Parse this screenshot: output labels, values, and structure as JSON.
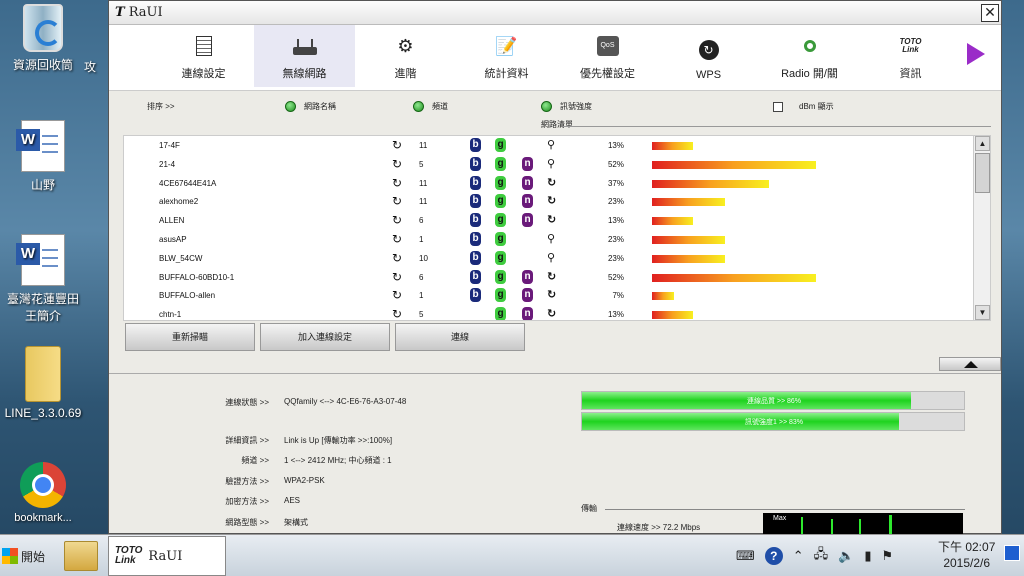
{
  "desktop": {
    "icons": [
      {
        "label": "資源回收筒"
      },
      {
        "label": "攻"
      },
      {
        "label": "山野"
      },
      {
        "label": "臺灣花蓮豐田\n王簡介"
      },
      {
        "label": "LINE_3.3.0.69"
      },
      {
        "label": "bookmark..."
      }
    ]
  },
  "window": {
    "logo": "T",
    "title": "RaUI",
    "close": "✕"
  },
  "toolbar": {
    "tabs": [
      {
        "label": "連線設定",
        "icon": "document-icon"
      },
      {
        "label": "無線網路",
        "icon": "router-icon"
      },
      {
        "label": "進階",
        "icon": "gear-icon"
      },
      {
        "label": "統計資料",
        "icon": "notepad-icon"
      },
      {
        "label": "優先權設定",
        "icon": "qos-icon"
      },
      {
        "label": "WPS",
        "icon": "wps-icon"
      },
      {
        "label": "Radio 開/關",
        "icon": "antenna-icon"
      },
      {
        "label": "資訊",
        "icon": "totolink-icon"
      }
    ],
    "qos_text": "QoS",
    "toto_text": "TOTO\nLink"
  },
  "list_header": {
    "sort": "排序 >>",
    "ssid": "網路名稱",
    "channel": "頻道",
    "signal": "訊號強度",
    "dbm": "dBm 顯示",
    "list_title": "網路清單"
  },
  "networks": [
    {
      "ssid": "17-4F",
      "channel": "11",
      "b": true,
      "g": true,
      "n": false,
      "sec": "key",
      "pct": "13%",
      "value": 13
    },
    {
      "ssid": "21-4",
      "channel": "5",
      "b": true,
      "g": true,
      "n": true,
      "sec": "key",
      "pct": "52%",
      "value": 52
    },
    {
      "ssid": "4CE67644E41A",
      "channel": "11",
      "b": true,
      "g": true,
      "n": true,
      "sec": "wps",
      "pct": "37%",
      "value": 37
    },
    {
      "ssid": "alexhome2",
      "channel": "11",
      "b": true,
      "g": true,
      "n": true,
      "sec": "wps",
      "pct": "23%",
      "value": 23
    },
    {
      "ssid": "ALLEN",
      "channel": "6",
      "b": true,
      "g": true,
      "n": true,
      "sec": "wps",
      "pct": "13%",
      "value": 13
    },
    {
      "ssid": "asusAP",
      "channel": "1",
      "b": true,
      "g": true,
      "n": false,
      "sec": "key",
      "pct": "23%",
      "value": 23
    },
    {
      "ssid": "BLW_54CW",
      "channel": "10",
      "b": true,
      "g": true,
      "n": false,
      "sec": "key",
      "pct": "23%",
      "value": 23
    },
    {
      "ssid": "BUFFALO-60BD10-1",
      "channel": "6",
      "b": true,
      "g": true,
      "n": true,
      "sec": "wps",
      "pct": "52%",
      "value": 52
    },
    {
      "ssid": "BUFFALO-allen",
      "channel": "1",
      "b": true,
      "g": true,
      "n": true,
      "sec": "wps",
      "pct": "7%",
      "value": 7
    },
    {
      "ssid": "chtn-1",
      "channel": "5",
      "b": false,
      "g": true,
      "n": true,
      "sec": "wps",
      "pct": "13%",
      "value": 13
    }
  ],
  "buttons": {
    "rescan": "重新掃瞄",
    "add_profile": "加入連線設定",
    "connect": "連線"
  },
  "status": {
    "labels": [
      "連線狀態 >>",
      "詳細資訊 >>",
      "頻道 >>",
      "驗證方法 >>",
      "加密方法 >>",
      "網路型態 >>"
    ],
    "values": [
      "QQfamily <--> 4C-E6-76-A3-07-48",
      "Link is Up [傳輸功率 >>:100%]",
      "1 <--> 2412 MHz; 中心頻道 : 1",
      "WPA2-PSK",
      "AES",
      "架構式"
    ],
    "quality_label": "連線品質 >> 86%",
    "quality_value": 86,
    "signal_label": "訊號強度1 >> 83%",
    "signal_value": 83,
    "transmit_label": "傳輸",
    "speed_label": "連線速度 >>  72.2 Mbps",
    "graph_max": "Max"
  },
  "taskbar": {
    "start": "開始",
    "app_logo": "TOTO\nLink",
    "app_name": "RaUI",
    "time": "下午 02:07",
    "date": "2015/2/6"
  },
  "colors": {
    "mode_b": "#1a2a7a",
    "mode_g": "#3fcc3f",
    "mode_n": "#6a1a7a",
    "accent_arrow": "#9a2cc8"
  }
}
